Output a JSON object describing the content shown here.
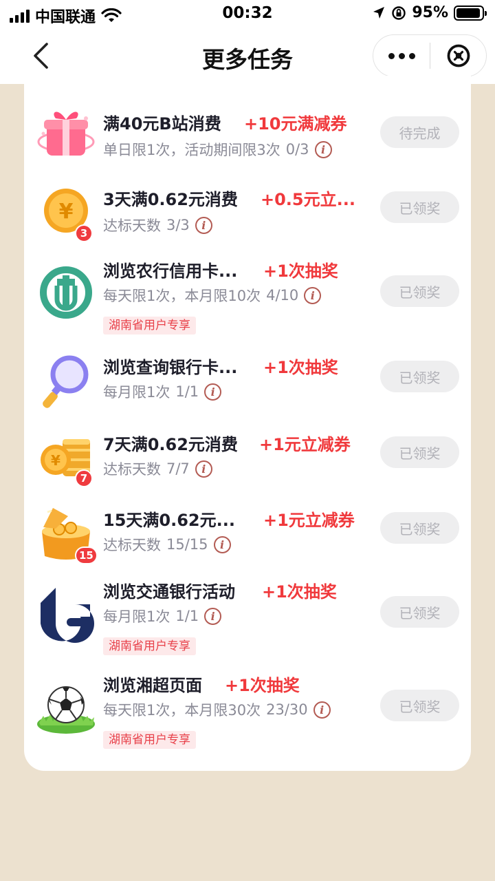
{
  "status_bar": {
    "carrier": "中国联通",
    "time": "00:32",
    "battery_text": "95%",
    "battery_level": 0.95
  },
  "nav": {
    "title": "更多任务",
    "back_icon": "chevron-left-icon",
    "more_icon": "ellipsis-icon",
    "close_icon": "circle-close-icon"
  },
  "colors": {
    "background": "#ece1cf",
    "reward": "#f0393c",
    "tag_bg": "#fde9ea",
    "tag_text": "#e8414a",
    "button_bg": "#eeeeef",
    "button_text": "#b2b2b8"
  },
  "tasks": [
    {
      "icon": "gift-box-icon",
      "title": "满40元B站消费",
      "reward": "+10元满减券",
      "desc": "单日限1次，活动期间限3次",
      "progress": "0/3",
      "button": "待完成"
    },
    {
      "icon": "yuan-coin-icon",
      "badge": "3",
      "title": "3天满0.62元消费",
      "reward": "+0.5元立...",
      "desc": "达标天数",
      "progress": "3/3",
      "button": "已领奖"
    },
    {
      "icon": "abc-bank-logo-icon",
      "title": "浏览农行信用卡...",
      "reward": "+1次抽奖",
      "desc": "每天限1次，本月限10次",
      "progress": "4/10",
      "tag": "湖南省用户专享",
      "button": "已领奖"
    },
    {
      "icon": "magnifier-icon",
      "title": "浏览查询银行卡...",
      "reward": "+1次抽奖",
      "desc": "每月限1次",
      "progress": "1/1",
      "button": "已领奖"
    },
    {
      "icon": "coin-stack-icon",
      "badge": "7",
      "title": "7天满0.62元消费",
      "reward": "+1元立减券",
      "desc": "达标天数",
      "progress": "7/7",
      "button": "已领奖"
    },
    {
      "icon": "treasure-chest-icon",
      "badge": "15",
      "title": "15天满0.62元...",
      "reward": "+1元立减券",
      "desc": "达标天数",
      "progress": "15/15",
      "button": "已领奖"
    },
    {
      "icon": "bocom-bank-logo-icon",
      "title": "浏览交通银行活动",
      "reward": "+1次抽奖",
      "desc": "每月限1次",
      "progress": "1/1",
      "tag": "湖南省用户专享",
      "button": "已领奖"
    },
    {
      "icon": "soccer-ball-icon",
      "title": "浏览湘超页面",
      "reward": "+1次抽奖",
      "desc": "每天限1次，本月限30次",
      "progress": "23/30",
      "tag": "湖南省用户专享",
      "button": "已领奖"
    }
  ]
}
